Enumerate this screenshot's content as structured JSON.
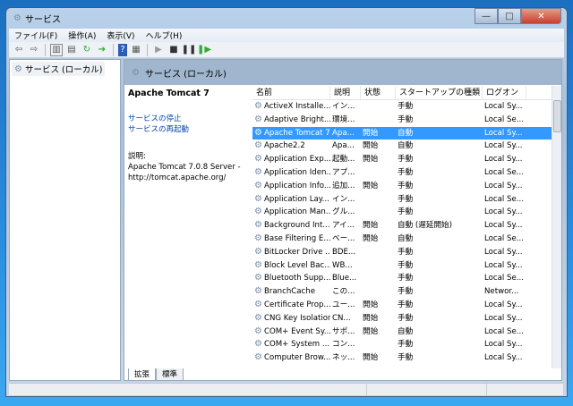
{
  "window": {
    "title": "サービス",
    "min": "—",
    "max": "□",
    "close": "✕"
  },
  "menu": [
    "ファイル(F)",
    "操作(A)",
    "表示(V)",
    "ヘルプ(H)"
  ],
  "toolbar": [
    "back-icon",
    "forward-icon",
    "show-hide-tree-icon",
    "properties-icon",
    "refresh-icon",
    "export-icon",
    "help-icon",
    "console-icon",
    "start-icon",
    "stop-icon",
    "pause-icon",
    "restart-icon"
  ],
  "tree": {
    "item": "サービス (ローカル)"
  },
  "pane": {
    "header": "サービス (ローカル)",
    "service_name": "Apache Tomcat 7",
    "stop_link": "サービスの停止",
    "restart_link": "サービスの再起動",
    "desc_label": "説明:",
    "desc_text": "Apache Tomcat 7.0.8 Server - http://tomcat.apache.org/"
  },
  "columns": [
    "名前",
    "説明",
    "状態",
    "スタートアップの種類",
    "ログオン"
  ],
  "rows": [
    [
      "ActiveX Installe...",
      "イン...",
      "",
      "手動",
      "Local Sy..."
    ],
    [
      "Adaptive Bright...",
      "環境...",
      "",
      "手動",
      "Local Se..."
    ],
    [
      "Apache Tomcat 7",
      "Apa...",
      "開始",
      "自動",
      "Local Sy..."
    ],
    [
      "Apache2.2",
      "Apa...",
      "開始",
      "自動",
      "Local Sy..."
    ],
    [
      "Application Exp...",
      "起動...",
      "開始",
      "手動",
      "Local Sy..."
    ],
    [
      "Application Iden...",
      "アプ...",
      "",
      "手動",
      "Local Se..."
    ],
    [
      "Application Info...",
      "追加...",
      "開始",
      "手動",
      "Local Sy..."
    ],
    [
      "Application Lay...",
      "イン...",
      "",
      "手動",
      "Local Se..."
    ],
    [
      "Application Man...",
      "グル...",
      "",
      "手動",
      "Local Sy..."
    ],
    [
      "Background Int...",
      "アイ...",
      "開始",
      "自動 (遅延開始)",
      "Local Sy..."
    ],
    [
      "Base Filtering E...",
      "ベー...",
      "開始",
      "自動",
      "Local Se..."
    ],
    [
      "BitLocker Drive ...",
      "BDE...",
      "",
      "手動",
      "Local Sy..."
    ],
    [
      "Block Level Bac...",
      "WB...",
      "",
      "手動",
      "Local Sy..."
    ],
    [
      "Bluetooth Supp...",
      "Blue...",
      "",
      "手動",
      "Local Se..."
    ],
    [
      "BranchCache",
      "この...",
      "",
      "手動",
      "Networ..."
    ],
    [
      "Certificate Prop...",
      "ユー...",
      "開始",
      "手動",
      "Local Sy..."
    ],
    [
      "CNG Key Isolation",
      "CN...",
      "開始",
      "手動",
      "Local Sy..."
    ],
    [
      "COM+ Event Sy...",
      "サポ...",
      "開始",
      "自動",
      "Local Se..."
    ],
    [
      "COM+ System ...",
      "コン...",
      "",
      "手動",
      "Local Sy..."
    ],
    [
      "Computer Brow...",
      "ネッ...",
      "開始",
      "手動",
      "Local Sy..."
    ]
  ],
  "selected_row": 2,
  "tabs": [
    "拡張",
    "標準"
  ],
  "colors": {
    "selection": "#3399ff",
    "band": "#a0b6cf"
  }
}
